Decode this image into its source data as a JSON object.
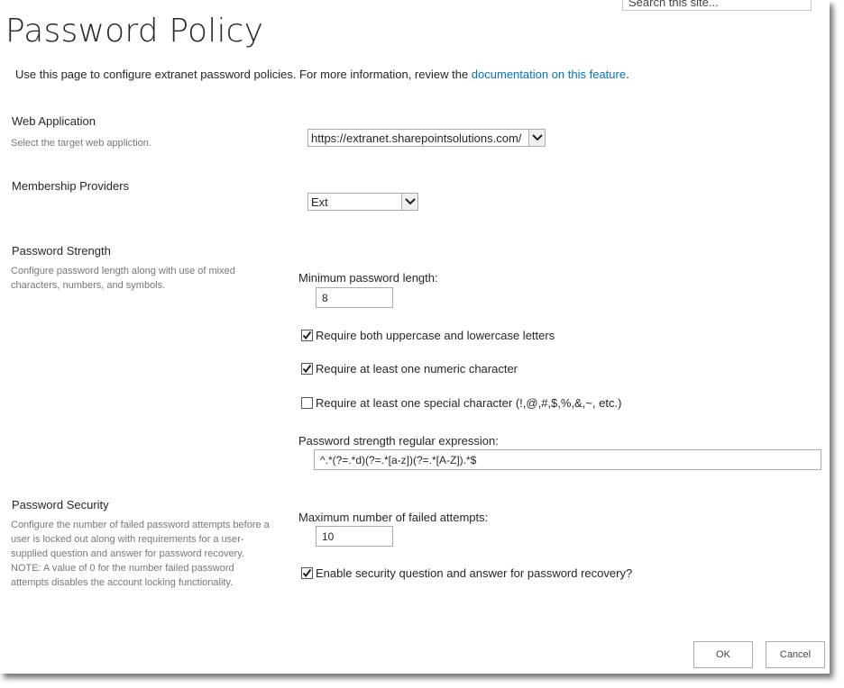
{
  "search": {
    "placeholder": "Search this site..."
  },
  "page": {
    "title": "Password Policy",
    "intro_text": "Use this page to configure extranet password policies. For more information, review the ",
    "intro_link": "documentation on this feature",
    "intro_end": "."
  },
  "sections": {
    "web_application": {
      "title": "Web Application",
      "description": "Select the target web appliction.",
      "selected": "https://extranet.sharepointsolutions.com/"
    },
    "membership_providers": {
      "title": "Membership Providers",
      "selected": "Ext"
    },
    "password_strength": {
      "title": "Password Strength",
      "description": "Configure password length along with use of mixed characters, numbers, and symbols.",
      "min_length_label": "Minimum password length:",
      "min_length_value": "8",
      "checkboxes": [
        {
          "label": "Require both uppercase and lowercase letters",
          "checked": true
        },
        {
          "label": "Require at least one numeric character",
          "checked": true
        },
        {
          "label": "Require at least one special character (!,@,#,$,%,&,~, etc.)",
          "checked": false
        }
      ],
      "regex_label": "Password strength regular expression:",
      "regex_value": "^.*(?=.*d)(?=.*[a-z])(?=.*[A-Z]).*$"
    },
    "password_security": {
      "title": "Password Security",
      "description": "Configure the number of failed password attempts before a user is locked out along with requirements for a user-supplied question and answer for password recovery. NOTE: A value of 0 for the number failed password attempts disables the account locking functionality.",
      "max_attempts_label": "Maximum number of failed attempts:",
      "max_attempts_value": "10",
      "security_question": {
        "label": "Enable security question and answer for password recovery?",
        "checked": true
      }
    }
  },
  "buttons": {
    "ok": "OK",
    "cancel": "Cancel"
  },
  "colors": {
    "link": "#0072c6",
    "title": "#262626",
    "description": "#777777"
  }
}
